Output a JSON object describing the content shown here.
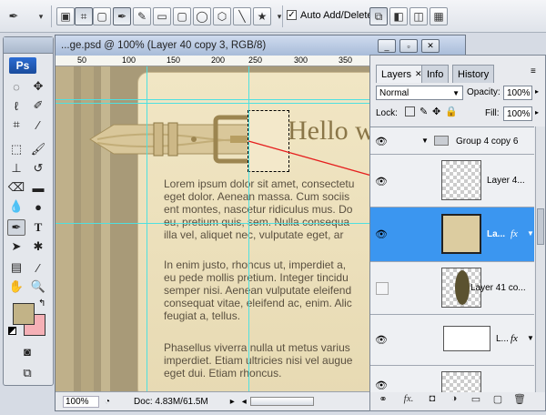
{
  "options_bar": {
    "auto_add_delete": "Auto Add/Delete",
    "auto_add_checked": true
  },
  "tools": {
    "logo": "Ps",
    "foreground_color": "#c2b387",
    "background_color": "#f5b0b6"
  },
  "document": {
    "title": "...ge.psd @ 100% (Layer 40 copy 3, RGB/8)",
    "ruler_ticks": [
      "50",
      "100",
      "150",
      "200",
      "250",
      "300",
      "350"
    ],
    "heading": "Hello w",
    "paragraphs": [
      "Lorem ipsum dolor sit amet, consectetu\neget dolor. Aenean massa. Cum sociis\nent montes, nascetur ridiculus mus. Do\neu, pretium quis, sem. Nulla consequa\nilla vel, aliquet nec, vulputate eget, ar",
      "In enim justo, rhoncus ut, imperdiet a,\neu pede mollis pretium. Integer tincidu\nsemper nisi. Aenean vulputate eleifend\nconsequat vitae, eleifend ac, enim. Alic\nfeugiat a, tellus.",
      "Phasellus viverra nulla ut metus varius\nimperdiet. Etiam ultricies nisi vel augue\neget dui. Etiam rhoncus."
    ],
    "zoom": "100%",
    "doc_size": "Doc: 4.83M/61.5M"
  },
  "layers_panel": {
    "tabs": [
      "Layers",
      "Info",
      "History"
    ],
    "blend_mode": "Normal",
    "opacity_label": "Opacity:",
    "opacity_value": "100%",
    "lock_label": "Lock:",
    "fill_label": "Fill:",
    "fill_value": "100%",
    "group_name": "Group 4 copy 6",
    "layers": [
      {
        "name": "Layer 4...",
        "visible": true
      },
      {
        "name": "La...",
        "visible": true,
        "selected": true,
        "fx": "fx"
      },
      {
        "name": "Layer 41 co...",
        "visible": false
      },
      {
        "name": "L...",
        "visible": true,
        "fx": "fx"
      }
    ]
  }
}
